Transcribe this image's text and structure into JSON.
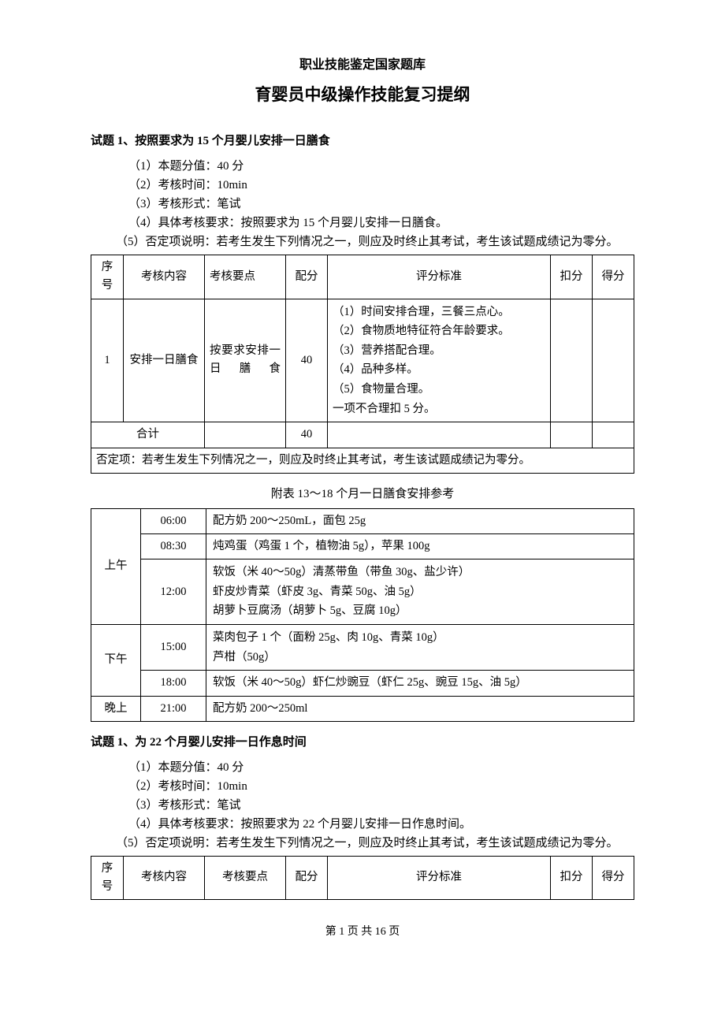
{
  "header": {
    "subtitle": "职业技能鉴定国家题库",
    "title": "育婴员中级操作技能复习提纲"
  },
  "q1": {
    "heading": "试题 1、按照要求为 15 个月婴儿安排一日膳食",
    "items": {
      "i1": "（1）本题分值：40 分",
      "i2": "（2）考核时间：10min",
      "i3": "（3）考核形式：笔试",
      "i4": "（4）具体考核要求：按照要求为 15 个月婴儿安排一日膳食。",
      "i5": "（5）否定项说明：若考生发生下列情况之一，则应及时终止其考试，考生该试题成绩记为零分。"
    },
    "table": {
      "h_seq": "序号",
      "h_content": "考核内容",
      "h_points": "考核要点",
      "h_alloc": "配分",
      "h_criteria": "评分标准",
      "h_deduct": "扣分",
      "h_score": "得分",
      "r1_seq": "1",
      "r1_content": "安排一日膳食",
      "r1_points": "按要求安排一日膳食",
      "r1_alloc": "40",
      "r1_criteria": "（1）时间安排合理，三餐三点心。\n（2）食物质地特征符合年龄要求。\n（3）营养搭配合理。\n（4）品种多样。\n（5）食物量合理。\n一项不合理扣 5 分。",
      "total_label": "合计",
      "total_alloc": "40",
      "disqualify": "否定项：若考生发生下列情况之一，则应及时终止其考试，考生该试题成绩记为零分。"
    }
  },
  "schedule": {
    "caption": "附表 13～18 个月一日膳食安排参考",
    "morning": "上午",
    "afternoon": "下午",
    "evening": "晚上",
    "t0600": "06:00",
    "d0600": "配方奶 200～250mL，面包 25g",
    "t0830": "08:30",
    "d0830": "炖鸡蛋（鸡蛋 1 个，植物油 5g），苹果 100g",
    "t1200": "12:00",
    "d1200": "软饭（米 40～50g）清蒸带鱼（带鱼 30g、盐少许）\n虾皮炒青菜（虾皮 3g、青菜 50g、油 5g）\n胡萝卜豆腐汤（胡萝卜 5g、豆腐 10g）",
    "t1500": "15:00",
    "d1500": "菜肉包子 1 个（面粉 25g、肉 10g、青菜 10g）\n芦柑（50g）",
    "t1800": "18:00",
    "d1800": "软饭（米 40～50g）虾仁炒豌豆（虾仁 25g、豌豆 15g、油 5g）",
    "t2100": "21:00",
    "d2100": "配方奶 200～250ml"
  },
  "q2": {
    "heading": "试题 1、为 22 个月婴儿安排一日作息时间",
    "items": {
      "i1": "（1）本题分值：40 分",
      "i2": "（2）考核时间：10min",
      "i3": "（3）考核形式：笔试",
      "i4": "（4）具体考核要求：按照要求为 22 个月婴儿安排一日作息时间。",
      "i5": "（5）否定项说明：若考生发生下列情况之一，则应及时终止其考试，考生该试题成绩记为零分。"
    },
    "table": {
      "h_seq": "序号",
      "h_content": "考核内容",
      "h_points": "考核要点",
      "h_alloc": "配分",
      "h_criteria": "评分标准",
      "h_deduct": "扣分",
      "h_score": "得分"
    }
  },
  "footer": {
    "pager": "第 1 页   共 16 页"
  }
}
